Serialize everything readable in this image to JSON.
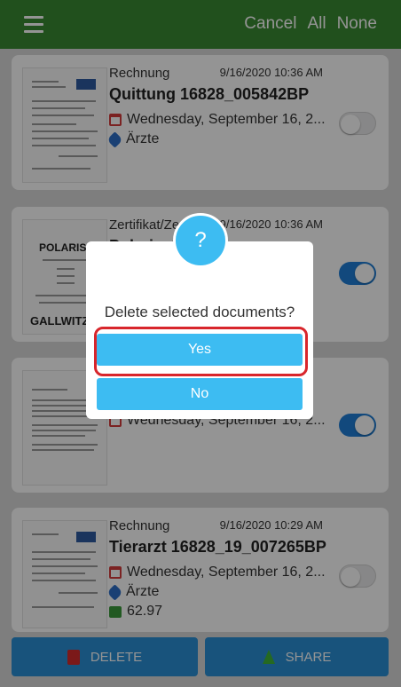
{
  "header": {
    "cancel_label": "Cancel",
    "all_label": "All",
    "none_label": "None",
    "color": "#3a8a32"
  },
  "documents": [
    {
      "type": "Rechnung",
      "datetime": "9/16/2020 10:36 AM",
      "title": "Quittung 16828_005842BP",
      "date_long": "Wednesday, September 16, 2...",
      "tag": "Ärzte",
      "selected": false
    },
    {
      "type": "Zertifikat/Ze",
      "datetime": "9/16/2020 10:36 AM",
      "title": "Polaris_S",
      "thumb_logo_top": "POLARIS",
      "thumb_logo_bottom": "GALLWITZ",
      "selected": true
    },
    {
      "date_long": "Wednesday, September 16, 2...",
      "selected": true
    },
    {
      "type": "Rechnung",
      "datetime": "9/16/2020 10:29 AM",
      "title": "Tierarzt 16828_19_007265BP",
      "date_long": "Wednesday, September 16, 2...",
      "tag": "Ärzte",
      "amount": "62.97",
      "selected": false
    }
  ],
  "bottom_bar": {
    "delete_label": "DELETE",
    "share_label": "SHARE",
    "color": "#2a8fd6"
  },
  "dialog": {
    "icon_glyph": "?",
    "message": "Delete selected documents?",
    "yes_label": "Yes",
    "no_label": "No",
    "accent": "#3dbcf2"
  }
}
